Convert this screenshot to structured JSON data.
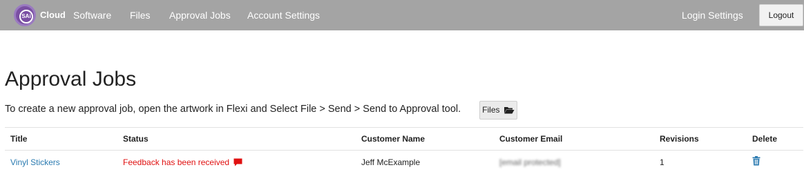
{
  "navbar": {
    "brand": "Cloud",
    "logo_text": "SAi",
    "items": [
      "Software",
      "Files",
      "Approval Jobs",
      "Account Settings"
    ],
    "login_settings": "Login Settings",
    "logout": "Logout"
  },
  "page": {
    "title": "Approval Jobs",
    "intro": "To create a new approval job, open the artwork in Flexi and Select File > Send > Send to Approval tool.",
    "files_button": "Files"
  },
  "table": {
    "headers": [
      "Title",
      "Status",
      "Customer Name",
      "Customer Email",
      "Revisions",
      "Delete"
    ],
    "rows": [
      {
        "title": "Vinyl Stickers",
        "status": "Feedback has been received",
        "customer_name": "Jeff McExample",
        "customer_email": "[email protected]",
        "revisions": "1"
      }
    ]
  },
  "colors": {
    "navbar": "#a4a4a4",
    "link": "#2a7ab0",
    "status_alert": "#e01010"
  }
}
